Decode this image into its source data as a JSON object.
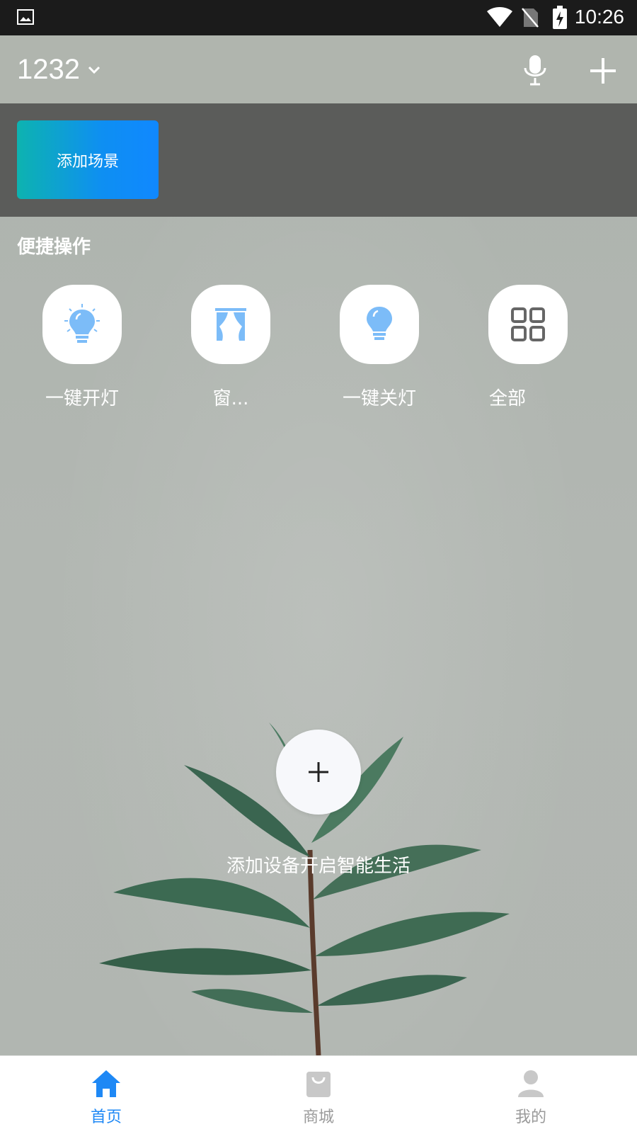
{
  "status_bar": {
    "time": "10:26"
  },
  "header": {
    "home_name": "1232"
  },
  "scene": {
    "add_scene_label": "添加场景"
  },
  "quick_actions": {
    "title": "便捷操作",
    "items": [
      {
        "label": "一键开灯",
        "icon": "bulb-on-icon"
      },
      {
        "label": "窗...",
        "icon": "curtain-icon"
      },
      {
        "label": "一键关灯",
        "icon": "bulb-off-icon"
      },
      {
        "label": "全部",
        "icon": "grid-icon"
      }
    ]
  },
  "empty_state": {
    "hint": "添加设备开启智能生活"
  },
  "tabs": [
    {
      "label": "首页",
      "icon": "home-icon",
      "active": true
    },
    {
      "label": "商城",
      "icon": "shop-bag-icon",
      "active": false
    },
    {
      "label": "我的",
      "icon": "profile-icon",
      "active": false
    }
  ],
  "colors": {
    "accent": "#1e88f5",
    "scene_gradient_start": "#0db3b0",
    "scene_gradient_end": "#1088ff",
    "icon_blue": "#7cbcf8"
  }
}
